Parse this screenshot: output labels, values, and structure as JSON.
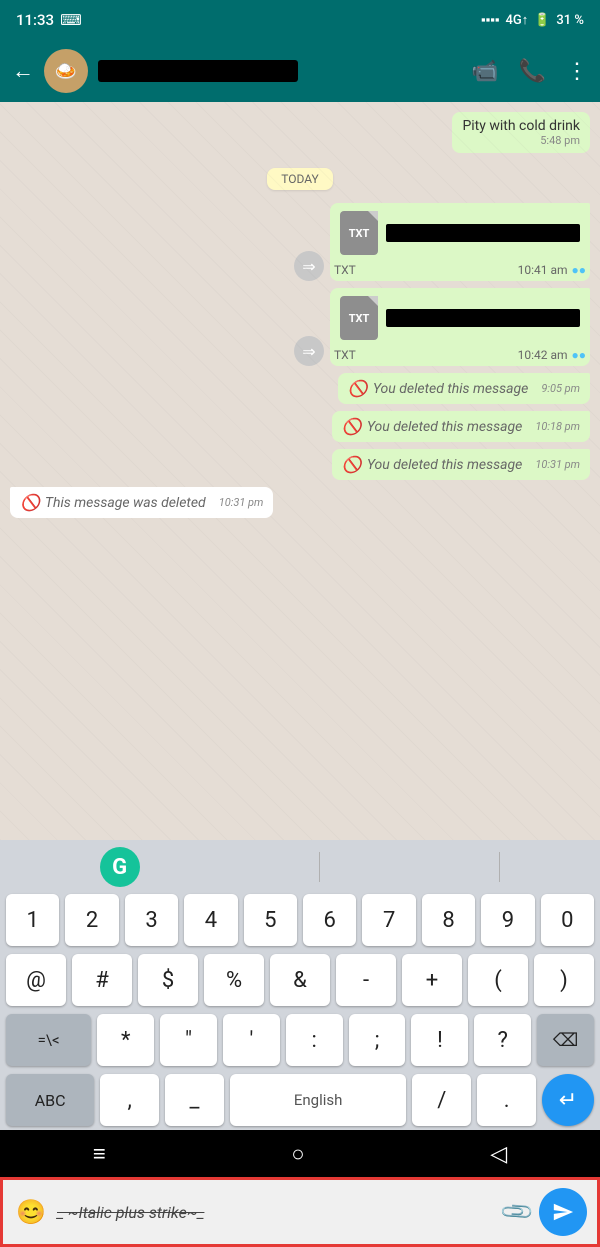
{
  "status_bar": {
    "time": "11:33",
    "signal": "4G↑",
    "battery": "31 %"
  },
  "header": {
    "contact_name": "",
    "avatar_emoji": "🍛"
  },
  "messages": [
    {
      "id": "msg1",
      "type": "outgoing_text",
      "text": "Pity with cold drink",
      "time": "5:48 pm",
      "status": "read"
    },
    {
      "id": "date_sep",
      "type": "date_separator",
      "label": "TODAY"
    },
    {
      "id": "msg2",
      "type": "outgoing_file",
      "file_type": "TXT",
      "time": "10:41 am",
      "status": "read"
    },
    {
      "id": "msg3",
      "type": "outgoing_file",
      "file_type": "TXT",
      "time": "10:42 am",
      "status": "read"
    },
    {
      "id": "msg4",
      "type": "outgoing_deleted",
      "text": "You deleted this message",
      "time": "9:05 pm"
    },
    {
      "id": "msg5",
      "type": "outgoing_deleted",
      "text": "You deleted this message",
      "time": "10:18 pm"
    },
    {
      "id": "msg6",
      "type": "outgoing_deleted",
      "text": "You deleted this message",
      "time": "10:31 pm"
    },
    {
      "id": "msg7",
      "type": "incoming_deleted",
      "text": "This message was deleted",
      "time": "10:31 pm"
    }
  ],
  "input": {
    "placeholder": "",
    "value": "_ ~Italic plus strike~_",
    "display_text": "Italic plus strike",
    "emoji_label": "😊",
    "attach_label": "📎",
    "send_label": "➤"
  },
  "keyboard": {
    "grammarly_letter": "G",
    "rows": {
      "numbers": [
        "1",
        "2",
        "3",
        "4",
        "5",
        "6",
        "7",
        "8",
        "9",
        "0"
      ],
      "symbols": [
        "@",
        "#",
        "$",
        "%",
        "&",
        "-",
        "+",
        "(",
        ")"
      ],
      "special": [
        "=\\<",
        "*",
        "\"",
        "'",
        ":",
        ";",
        " !",
        "?",
        "⌫"
      ],
      "bottom": [
        "ABC",
        ",",
        " _",
        "English",
        "/",
        " .",
        " ↵"
      ]
    }
  },
  "nav": {
    "menu_label": "≡",
    "home_label": "○",
    "back_label": "◁"
  }
}
